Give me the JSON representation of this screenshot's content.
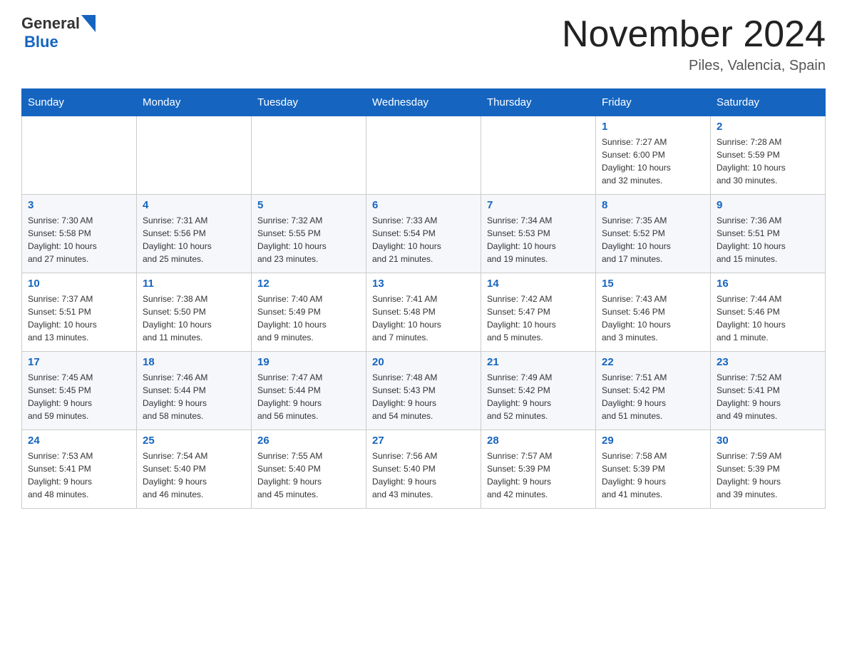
{
  "header": {
    "logo_general": "General",
    "logo_blue": "Blue",
    "title": "November 2024",
    "subtitle": "Piles, Valencia, Spain"
  },
  "days_of_week": [
    "Sunday",
    "Monday",
    "Tuesday",
    "Wednesday",
    "Thursday",
    "Friday",
    "Saturday"
  ],
  "weeks": [
    {
      "days": [
        {
          "number": "",
          "info": ""
        },
        {
          "number": "",
          "info": ""
        },
        {
          "number": "",
          "info": ""
        },
        {
          "number": "",
          "info": ""
        },
        {
          "number": "",
          "info": ""
        },
        {
          "number": "1",
          "info": "Sunrise: 7:27 AM\nSunset: 6:00 PM\nDaylight: 10 hours\nand 32 minutes."
        },
        {
          "number": "2",
          "info": "Sunrise: 7:28 AM\nSunset: 5:59 PM\nDaylight: 10 hours\nand 30 minutes."
        }
      ]
    },
    {
      "days": [
        {
          "number": "3",
          "info": "Sunrise: 7:30 AM\nSunset: 5:58 PM\nDaylight: 10 hours\nand 27 minutes."
        },
        {
          "number": "4",
          "info": "Sunrise: 7:31 AM\nSunset: 5:56 PM\nDaylight: 10 hours\nand 25 minutes."
        },
        {
          "number": "5",
          "info": "Sunrise: 7:32 AM\nSunset: 5:55 PM\nDaylight: 10 hours\nand 23 minutes."
        },
        {
          "number": "6",
          "info": "Sunrise: 7:33 AM\nSunset: 5:54 PM\nDaylight: 10 hours\nand 21 minutes."
        },
        {
          "number": "7",
          "info": "Sunrise: 7:34 AM\nSunset: 5:53 PM\nDaylight: 10 hours\nand 19 minutes."
        },
        {
          "number": "8",
          "info": "Sunrise: 7:35 AM\nSunset: 5:52 PM\nDaylight: 10 hours\nand 17 minutes."
        },
        {
          "number": "9",
          "info": "Sunrise: 7:36 AM\nSunset: 5:51 PM\nDaylight: 10 hours\nand 15 minutes."
        }
      ]
    },
    {
      "days": [
        {
          "number": "10",
          "info": "Sunrise: 7:37 AM\nSunset: 5:51 PM\nDaylight: 10 hours\nand 13 minutes."
        },
        {
          "number": "11",
          "info": "Sunrise: 7:38 AM\nSunset: 5:50 PM\nDaylight: 10 hours\nand 11 minutes."
        },
        {
          "number": "12",
          "info": "Sunrise: 7:40 AM\nSunset: 5:49 PM\nDaylight: 10 hours\nand 9 minutes."
        },
        {
          "number": "13",
          "info": "Sunrise: 7:41 AM\nSunset: 5:48 PM\nDaylight: 10 hours\nand 7 minutes."
        },
        {
          "number": "14",
          "info": "Sunrise: 7:42 AM\nSunset: 5:47 PM\nDaylight: 10 hours\nand 5 minutes."
        },
        {
          "number": "15",
          "info": "Sunrise: 7:43 AM\nSunset: 5:46 PM\nDaylight: 10 hours\nand 3 minutes."
        },
        {
          "number": "16",
          "info": "Sunrise: 7:44 AM\nSunset: 5:46 PM\nDaylight: 10 hours\nand 1 minute."
        }
      ]
    },
    {
      "days": [
        {
          "number": "17",
          "info": "Sunrise: 7:45 AM\nSunset: 5:45 PM\nDaylight: 9 hours\nand 59 minutes."
        },
        {
          "number": "18",
          "info": "Sunrise: 7:46 AM\nSunset: 5:44 PM\nDaylight: 9 hours\nand 58 minutes."
        },
        {
          "number": "19",
          "info": "Sunrise: 7:47 AM\nSunset: 5:44 PM\nDaylight: 9 hours\nand 56 minutes."
        },
        {
          "number": "20",
          "info": "Sunrise: 7:48 AM\nSunset: 5:43 PM\nDaylight: 9 hours\nand 54 minutes."
        },
        {
          "number": "21",
          "info": "Sunrise: 7:49 AM\nSunset: 5:42 PM\nDaylight: 9 hours\nand 52 minutes."
        },
        {
          "number": "22",
          "info": "Sunrise: 7:51 AM\nSunset: 5:42 PM\nDaylight: 9 hours\nand 51 minutes."
        },
        {
          "number": "23",
          "info": "Sunrise: 7:52 AM\nSunset: 5:41 PM\nDaylight: 9 hours\nand 49 minutes."
        }
      ]
    },
    {
      "days": [
        {
          "number": "24",
          "info": "Sunrise: 7:53 AM\nSunset: 5:41 PM\nDaylight: 9 hours\nand 48 minutes."
        },
        {
          "number": "25",
          "info": "Sunrise: 7:54 AM\nSunset: 5:40 PM\nDaylight: 9 hours\nand 46 minutes."
        },
        {
          "number": "26",
          "info": "Sunrise: 7:55 AM\nSunset: 5:40 PM\nDaylight: 9 hours\nand 45 minutes."
        },
        {
          "number": "27",
          "info": "Sunrise: 7:56 AM\nSunset: 5:40 PM\nDaylight: 9 hours\nand 43 minutes."
        },
        {
          "number": "28",
          "info": "Sunrise: 7:57 AM\nSunset: 5:39 PM\nDaylight: 9 hours\nand 42 minutes."
        },
        {
          "number": "29",
          "info": "Sunrise: 7:58 AM\nSunset: 5:39 PM\nDaylight: 9 hours\nand 41 minutes."
        },
        {
          "number": "30",
          "info": "Sunrise: 7:59 AM\nSunset: 5:39 PM\nDaylight: 9 hours\nand 39 minutes."
        }
      ]
    }
  ]
}
